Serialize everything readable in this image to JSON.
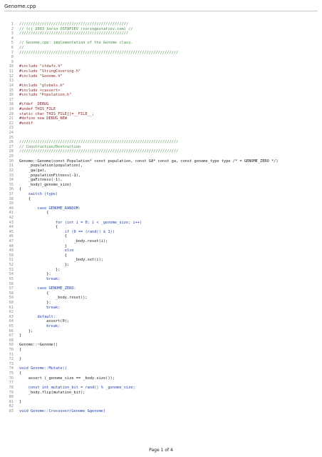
{
  "document": {
    "title": "Genome.cpp",
    "footer": "Page 1 of 4",
    "colors": {
      "comment": "#3f8f3f",
      "preprocessor": "#8a1e1e",
      "keyword": "#1f3fae",
      "plain": "#1a1a1a",
      "line_number": "#8a8a8a"
    }
  },
  "code_lines": [
    {
      "n": "1",
      "t": "////////////////////////////////////////////////",
      "k": "comment"
    },
    {
      "n": "2",
      "t": "// (c) 2003 Sorin OSTAFIEV (sorin@ostafiev.com) //",
      "k": "comment"
    },
    {
      "n": "3",
      "t": "////////////////////////////////////////////////",
      "k": "comment"
    },
    {
      "n": "4",
      "t": "",
      "k": "plain"
    },
    {
      "n": "5",
      "t": "// Genome.cpp: implementation of the Genome class.",
      "k": "comment"
    },
    {
      "n": "6",
      "t": "//",
      "k": "comment"
    },
    {
      "n": "7",
      "t": "//////////////////////////////////////////////////////////////////////",
      "k": "comment"
    },
    {
      "n": "8",
      "t": "",
      "k": "plain"
    },
    {
      "n": "9",
      "t": "",
      "k": "plain"
    },
    {
      "n": "10",
      "t": "#include \"stdafx.h\"",
      "k": "pre"
    },
    {
      "n": "11",
      "t": "#include \"StringCovering.h\"",
      "k": "pre"
    },
    {
      "n": "12",
      "t": "#include \"Genome.h\"",
      "k": "pre"
    },
    {
      "n": "13",
      "t": "",
      "k": "plain"
    },
    {
      "n": "14",
      "t": "#include \"globals.h\"",
      "k": "pre"
    },
    {
      "n": "15",
      "t": "#include <cassert>",
      "k": "pre"
    },
    {
      "n": "16",
      "t": "#include \"Population.h\"",
      "k": "pre"
    },
    {
      "n": "17",
      "t": "",
      "k": "plain"
    },
    {
      "n": "18",
      "t": "#ifdef _DEBUG",
      "k": "pre"
    },
    {
      "n": "19",
      "t": "#undef THIS_FILE",
      "k": "pre"
    },
    {
      "n": "20",
      "t": "static char THIS_FILE[]=__FILE__;",
      "k": "pre"
    },
    {
      "n": "21",
      "t": "#define new DEBUG_NEW",
      "k": "pre"
    },
    {
      "n": "22",
      "t": "#endif",
      "k": "pre"
    },
    {
      "n": "23",
      "t": "",
      "k": "plain"
    },
    {
      "n": "24",
      "t": "",
      "k": "plain"
    },
    {
      "n": "25",
      "t": "",
      "k": "plain"
    },
    {
      "n": "26",
      "t": "//////////////////////////////////////////////////////////////////////",
      "k": "comment"
    },
    {
      "n": "27",
      "t": "// Construction/Destruction",
      "k": "comment"
    },
    {
      "n": "28",
      "t": "//////////////////////////////////////////////////////////////////////",
      "k": "comment"
    },
    {
      "n": "29",
      "t": "",
      "k": "plain"
    },
    {
      "n": "30",
      "t": "Genome::Genome(const Population* const population, const GA* const ga, const genome_type type /* = GENOME_ZERO */)",
      "k": "plain"
    },
    {
      "n": "31",
      "t": "    _population(population),",
      "k": "plain"
    },
    {
      "n": "32",
      "t": "    _ga(ga),",
      "k": "plain"
    },
    {
      "n": "33",
      "t": "    _populationFitness(-1),",
      "k": "plain"
    },
    {
      "n": "34",
      "t": "    _gaFitness(-1),",
      "k": "plain"
    },
    {
      "n": "35",
      "t": "    _body(_genome_size)",
      "k": "plain"
    },
    {
      "n": "36",
      "t": "{",
      "k": "plain"
    },
    {
      "n": "37",
      "t": "    switch (type)",
      "k": "kw"
    },
    {
      "n": "38",
      "t": "    {",
      "k": "plain"
    },
    {
      "n": "39",
      "t": "",
      "k": "plain"
    },
    {
      "n": "40",
      "t": "        case GENOME_RANDOM:",
      "k": "kw"
    },
    {
      "n": "41",
      "t": "            {",
      "k": "plain"
    },
    {
      "n": "42",
      "t": "",
      "k": "plain"
    },
    {
      "n": "43",
      "t": "                for (int i = 0; i < _genome_size; i++)",
      "k": "kw"
    },
    {
      "n": "44",
      "t": "                {",
      "k": "plain"
    },
    {
      "n": "45",
      "t": "                    if (0 == (rand() & 1))",
      "k": "kw"
    },
    {
      "n": "46",
      "t": "                    {",
      "k": "plain"
    },
    {
      "n": "47",
      "t": "                        _body.reset(i);",
      "k": "plain"
    },
    {
      "n": "48",
      "t": "                    }",
      "k": "plain"
    },
    {
      "n": "49",
      "t": "                    else",
      "k": "kw"
    },
    {
      "n": "50",
      "t": "                    {",
      "k": "plain"
    },
    {
      "n": "51",
      "t": "                        _body.set(i);",
      "k": "plain"
    },
    {
      "n": "52",
      "t": "                    };",
      "k": "plain"
    },
    {
      "n": "53",
      "t": "                };",
      "k": "plain"
    },
    {
      "n": "54",
      "t": "            };",
      "k": "plain"
    },
    {
      "n": "55",
      "t": "            break;",
      "k": "kw"
    },
    {
      "n": "56",
      "t": "",
      "k": "plain"
    },
    {
      "n": "57",
      "t": "        case GENOME_ZERO:",
      "k": "kw"
    },
    {
      "n": "58",
      "t": "            {",
      "k": "plain"
    },
    {
      "n": "59",
      "t": "                _body.reset();",
      "k": "plain"
    },
    {
      "n": "60",
      "t": "            };",
      "k": "plain"
    },
    {
      "n": "61",
      "t": "            break;",
      "k": "kw"
    },
    {
      "n": "62",
      "t": "",
      "k": "plain"
    },
    {
      "n": "63",
      "t": "        default:",
      "k": "kw"
    },
    {
      "n": "64",
      "t": "            assert(0);",
      "k": "plain"
    },
    {
      "n": "65",
      "t": "            break;",
      "k": "kw"
    },
    {
      "n": "66",
      "t": "    };",
      "k": "plain"
    },
    {
      "n": "67",
      "t": "}",
      "k": "plain"
    },
    {
      "n": "68",
      "t": "",
      "k": "plain"
    },
    {
      "n": "69",
      "t": "Genome::~Genome()",
      "k": "plain"
    },
    {
      "n": "70",
      "t": "{",
      "k": "plain"
    },
    {
      "n": "71",
      "t": "",
      "k": "plain"
    },
    {
      "n": "72",
      "t": "}",
      "k": "plain"
    },
    {
      "n": "73",
      "t": "",
      "k": "plain"
    },
    {
      "n": "74",
      "t": "void Genome::Mutate()",
      "k": "kw"
    },
    {
      "n": "75",
      "t": "{",
      "k": "plain"
    },
    {
      "n": "76",
      "t": "    assert (_genome_size == _body.size());",
      "k": "plain"
    },
    {
      "n": "77",
      "t": "",
      "k": "plain"
    },
    {
      "n": "78",
      "t": "    const int mutation_bit = rand() % _genome_size;",
      "k": "kw"
    },
    {
      "n": "79",
      "t": "    _body.flip(mutation_bit);",
      "k": "plain"
    },
    {
      "n": "80",
      "t": "",
      "k": "plain"
    },
    {
      "n": "81",
      "t": "}",
      "k": "plain"
    },
    {
      "n": "82",
      "t": "",
      "k": "plain"
    },
    {
      "n": "83",
      "t": "void Genome::Crossover(Genome &genome)",
      "k": "kw"
    }
  ]
}
